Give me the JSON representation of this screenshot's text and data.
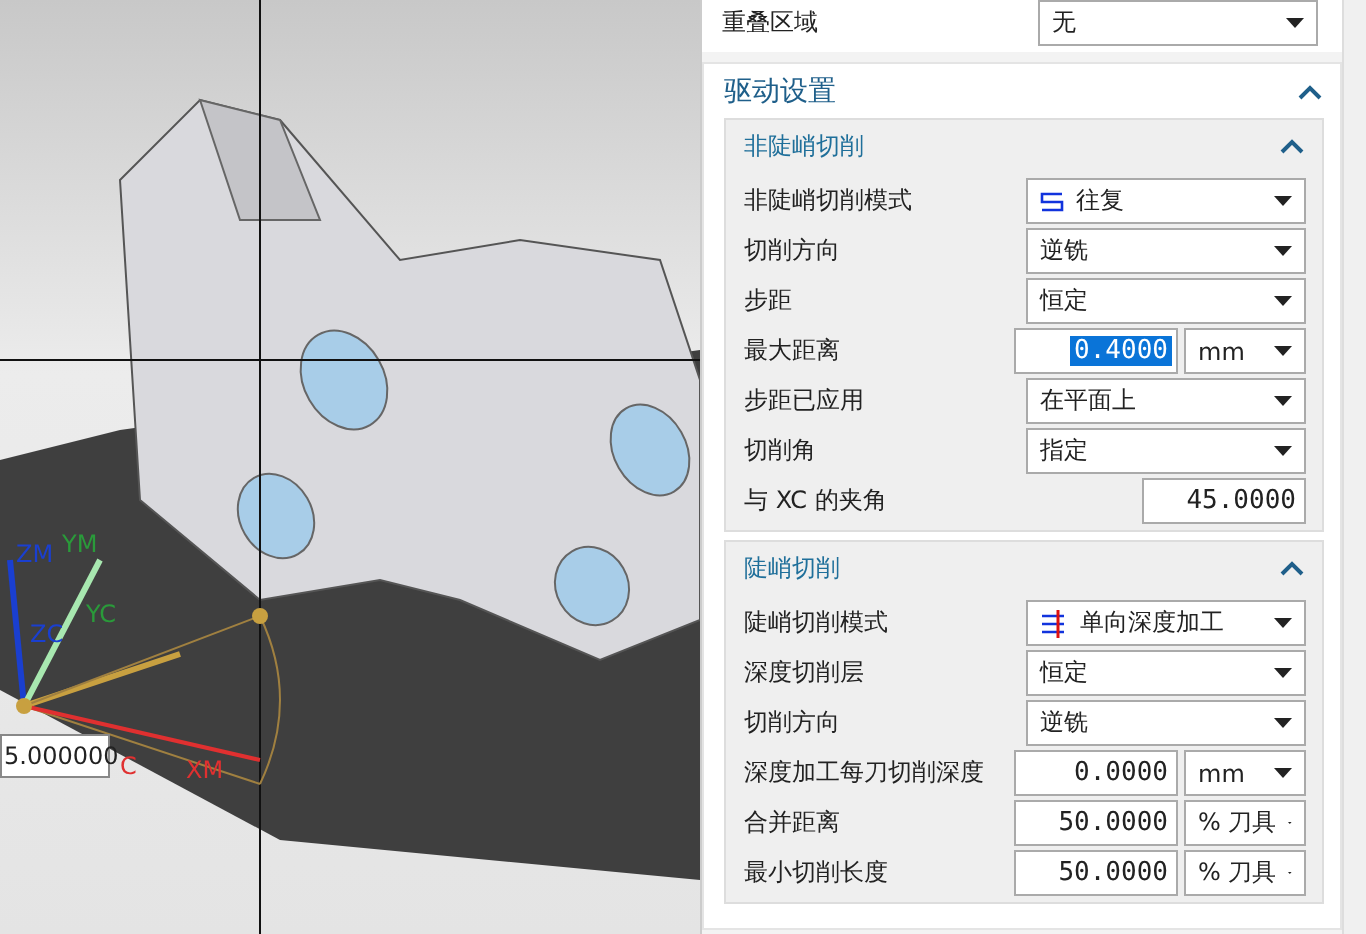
{
  "viewport": {
    "axis_labels": [
      {
        "text": "ZM",
        "color": "#1a3fd0"
      },
      {
        "text": "YM",
        "color": "#2a9a3a"
      },
      {
        "text": "ZC",
        "color": "#1a3fd0"
      },
      {
        "text": "YC",
        "color": "#2a9a3a"
      },
      {
        "text": "C",
        "color": "#e03030"
      },
      {
        "text": "XM",
        "color": "#e03030"
      }
    ],
    "angle_input": "5.000000"
  },
  "overlap": {
    "label": "重叠区域",
    "value": "无"
  },
  "section": {
    "title": "驱动设置",
    "expanded": true,
    "groups": [
      {
        "title": "非陡峭切削",
        "expanded": true,
        "rows": [
          {
            "kind": "zigzagselect",
            "label": "非陡峭切削模式",
            "value": "往复"
          },
          {
            "kind": "select",
            "label": "切削方向",
            "value": "逆铣"
          },
          {
            "kind": "select",
            "label": "步距",
            "value": "恒定"
          },
          {
            "kind": "numunit",
            "label": "最大距离",
            "value": "0.4000",
            "unit": "mm",
            "highlighted": true
          },
          {
            "kind": "select",
            "label": "步距已应用",
            "value": "在平面上"
          },
          {
            "kind": "select",
            "label": "切削角",
            "value": "指定"
          },
          {
            "kind": "number",
            "label": "与 XC 的夹角",
            "value": "45.0000"
          }
        ]
      },
      {
        "title": "陡峭切削",
        "expanded": true,
        "rows": [
          {
            "kind": "depthselect",
            "label": "陡峭切削模式",
            "value": "单向深度加工"
          },
          {
            "kind": "select",
            "label": "深度切削层",
            "value": "恒定"
          },
          {
            "kind": "select",
            "label": "切削方向",
            "value": "逆铣"
          },
          {
            "kind": "numunit",
            "label": "深度加工每刀切削深度",
            "value": "0.0000",
            "unit": "mm",
            "highlighted": false
          },
          {
            "kind": "numunit",
            "label": "合并距离",
            "value": "50.0000",
            "unit": "% 刀具",
            "highlighted": false
          },
          {
            "kind": "numunit",
            "label": "最小切削长度",
            "value": "50.0000",
            "unit": "% 刀具",
            "highlighted": false
          }
        ]
      }
    ]
  }
}
